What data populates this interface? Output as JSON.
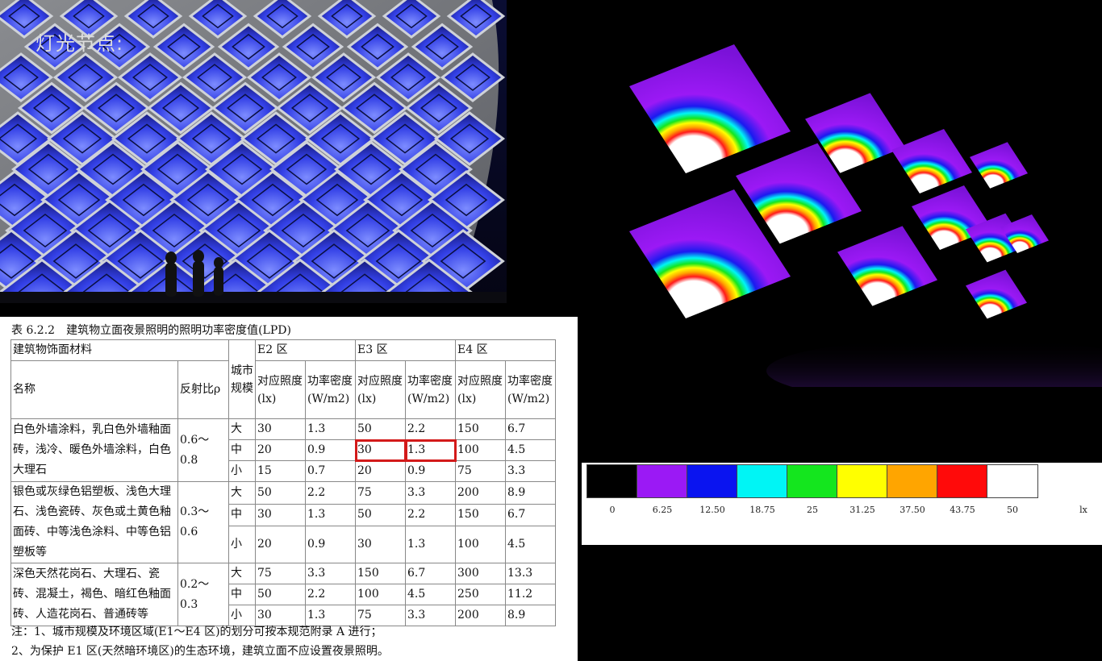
{
  "facade": {
    "title": "灯光节点:"
  },
  "table": {
    "caption": "表 6.2.2　建筑物立面夜景照明的照明功率密度值(LPD)",
    "group_header": "建筑物饰面材料",
    "col_name": "名称",
    "col_reflect": "反射比ρ",
    "col_scale": "城市规模",
    "zone_e2": "E2 区",
    "zone_e3": "E3 区",
    "zone_e4": "E4 区",
    "col_illum": "对应照度(lx)",
    "col_power": "功率密度(W/m2)",
    "groups": [
      {
        "material": "白色外墙涂料，乳白色外墙釉面砖，浅冷、暖色外墙涂料，白色大理石",
        "reflect": "0.6～0.8",
        "rows": [
          [
            "大",
            "30",
            "1.3",
            "50",
            "2.2",
            "150",
            "6.7"
          ],
          [
            "中",
            "20",
            "0.9",
            "30",
            "1.3",
            "100",
            "4.5"
          ],
          [
            "小",
            "15",
            "0.7",
            "20",
            "0.9",
            "75",
            "3.3"
          ]
        ]
      },
      {
        "material": "银色或灰绿色铝塑板、浅色大理石、浅色瓷砖、灰色或土黄色釉面砖、中等浅色涂料、中等色铝塑板等",
        "reflect": "0.3～0.6",
        "rows": [
          [
            "大",
            "50",
            "2.2",
            "75",
            "3.3",
            "200",
            "8.9"
          ],
          [
            "中",
            "30",
            "1.3",
            "50",
            "2.2",
            "150",
            "6.7"
          ],
          [
            "小",
            "20",
            "0.9",
            "30",
            "1.3",
            "100",
            "4.5"
          ]
        ]
      },
      {
        "material": "深色天然花岗石、大理石、瓷砖、混凝土，褐色、暗红色釉面砖、人造花岗石、普通砖等",
        "reflect": "0.2～0.3",
        "rows": [
          [
            "大",
            "75",
            "3.3",
            "150",
            "6.7",
            "300",
            "13.3"
          ],
          [
            "中",
            "50",
            "2.2",
            "100",
            "4.5",
            "250",
            "11.2"
          ],
          [
            "小",
            "30",
            "1.3",
            "75",
            "3.3",
            "200",
            "8.9"
          ]
        ]
      }
    ],
    "note1": "注：1、城市规模及环境区域(E1～E4 区)的划分可按本规范附录 A 进行；",
    "note2": "2、为保护 E1 区(天然暗环境区)的生态环境，建筑立面不应设置夜景照明。",
    "highlight_color": "#d31a1a"
  },
  "legend": {
    "colors": [
      "#000000",
      "#9b19f5",
      "#0a14f0",
      "#00f5f5",
      "#14e61e",
      "#ffff00",
      "#ffa500",
      "#ff0a0a",
      "#ffffff"
    ],
    "labels": [
      "0",
      "6.25",
      "12.50",
      "18.75",
      "25",
      "31.25",
      "37.50",
      "43.75",
      "50"
    ],
    "unit": "lx"
  }
}
